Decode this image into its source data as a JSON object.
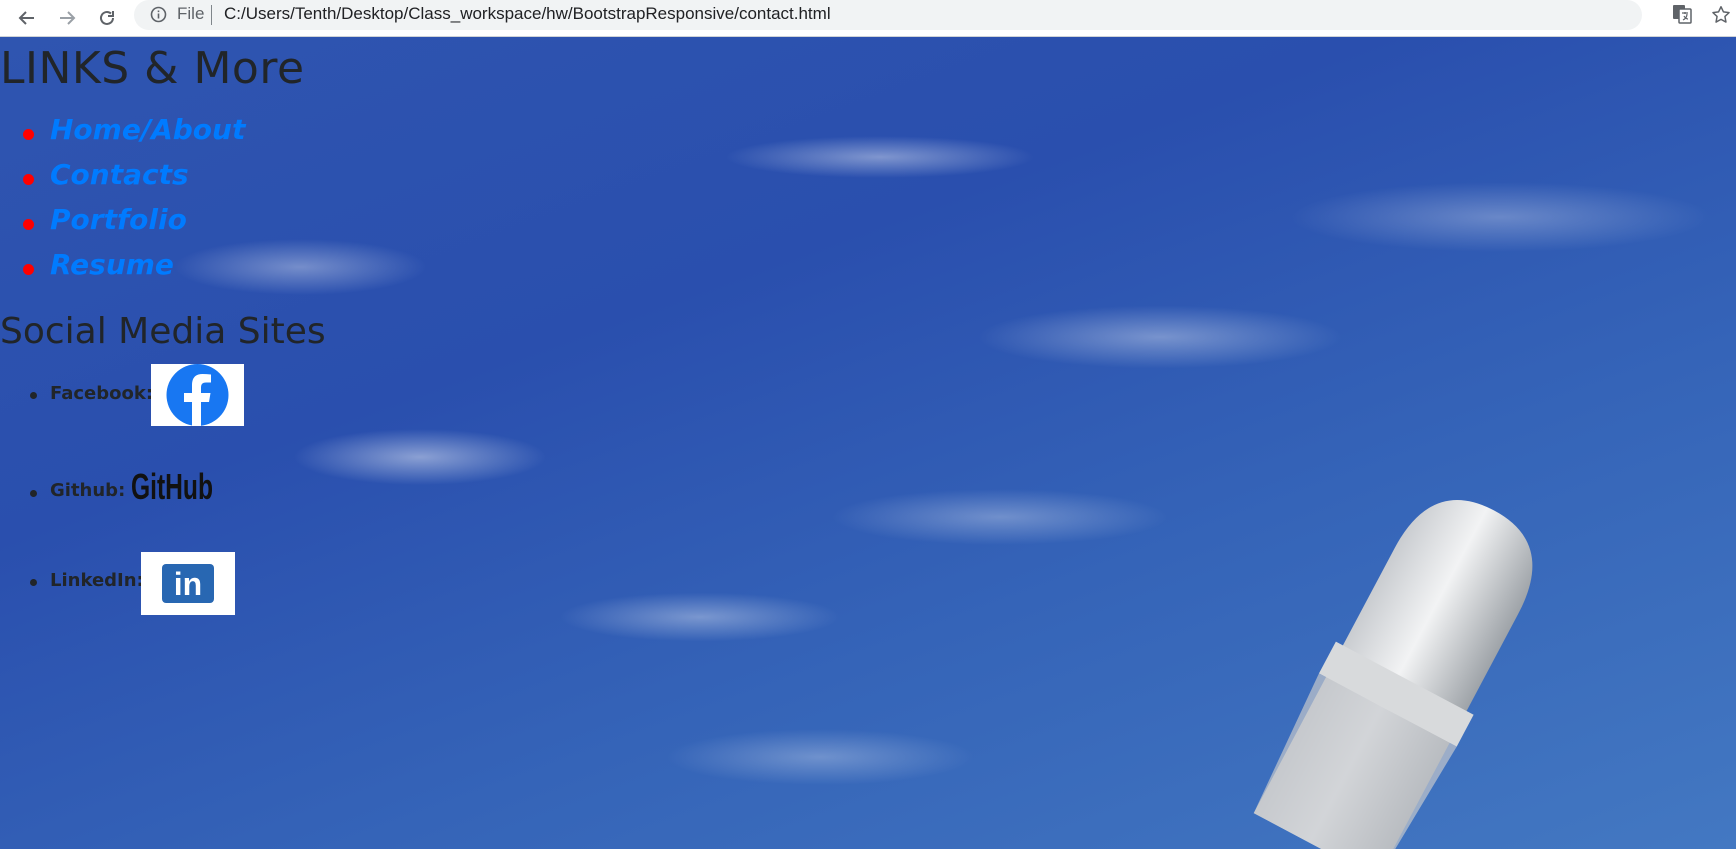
{
  "browser": {
    "scheme_label": "File",
    "url": "C:/Users/Tenth/Desktop/Class_workspace/hw/BootstrapResponsive/contact.html",
    "icons": [
      "back-icon",
      "forward-icon",
      "reload-icon",
      "info-icon",
      "translate-icon",
      "star-icon"
    ]
  },
  "page": {
    "title": "LINKS & More",
    "nav_links": [
      {
        "label": "Home/About"
      },
      {
        "label": "Contacts"
      },
      {
        "label": "Portfolio"
      },
      {
        "label": "Resume"
      }
    ],
    "social_title": "Social Media Sites",
    "social": [
      {
        "label": "Facebook:",
        "icon": "facebook-logo-icon"
      },
      {
        "label": "Github:",
        "icon": "github-logo",
        "logo_text": "GitHub"
      },
      {
        "label": "LinkedIn:",
        "icon": "linkedin-logo-icon",
        "logo_text": "in"
      }
    ]
  },
  "colors": {
    "link": "#007bff",
    "bullet_accent": "#ff0000",
    "text": "#212529",
    "sky": "#2f55b0",
    "facebook": "#1877f2",
    "linkedin": "#2867b2"
  }
}
